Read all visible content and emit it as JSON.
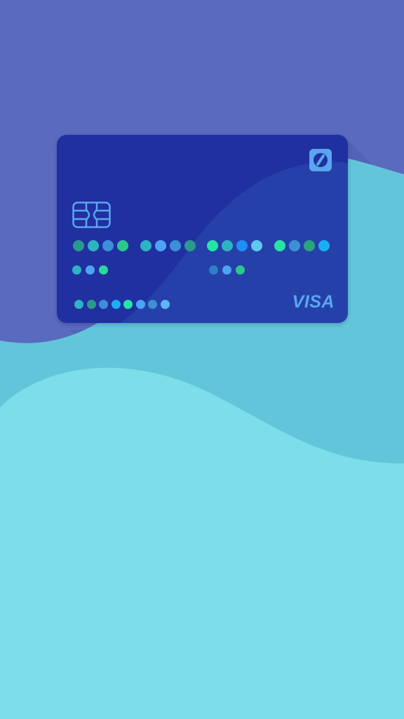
{
  "screen": {
    "background_top": "#5a6abf",
    "wave_mid": "#63c5d9",
    "wave_bottom": "#7ddde9"
  },
  "card": {
    "color": "#2030a0",
    "brand_icon": "bank-logo-icon",
    "chip_icon": "emv-chip-icon",
    "network_label": "VISA",
    "accent": "#5aa6ee",
    "masked_number_dot_colors": [
      [
        "#2a9a8c",
        "#2fb3c2",
        "#3d8fd6",
        "#2cc78f"
      ],
      [
        "#2fb3c2",
        "#4fa3f5",
        "#3d8fd6",
        "#2a9a8c"
      ],
      [
        "#26e4a4",
        "#2fb3c2",
        "#1f8ef5",
        "#5fc9f2"
      ],
      [
        "#26e4a4",
        "#3d8fd6",
        "#2aa47c",
        "#1aaef5"
      ]
    ],
    "masked_expiry_dot_colors": [
      "#2fb3c2",
      "#4fa3f5",
      "#2cd89a"
    ],
    "masked_cvv_dot_colors": [
      "#2f7fc8",
      "#4fa3f5",
      "#2cc78f"
    ],
    "masked_holder_dot_colors": [
      "#2fb3c2",
      "#2a9a8c",
      "#3d8fd6",
      "#1aaef5",
      "#26e4a4",
      "#4fa3f5",
      "#3d8fd6",
      "#5fb5f5"
    ]
  }
}
